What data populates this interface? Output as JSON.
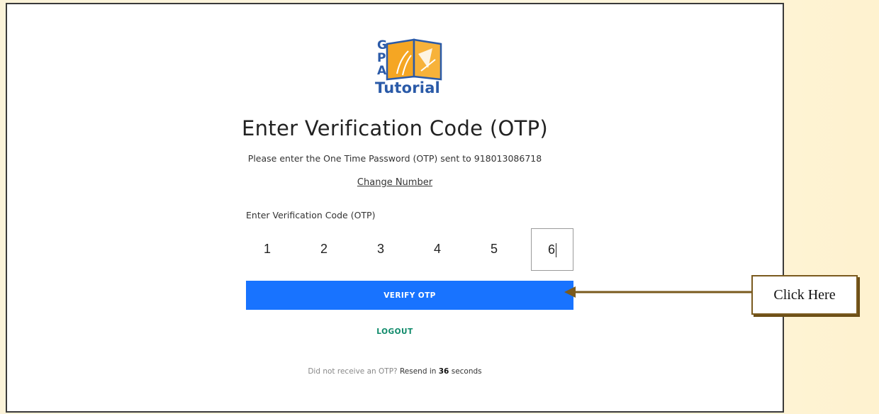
{
  "logo": {
    "letters": [
      "G",
      "P",
      "A"
    ],
    "wordmark": "Tutorial"
  },
  "title": "Enter Verification Code (OTP)",
  "subtitle": "Please enter the One Time Password (OTP) sent to 918013086718",
  "change_number": "Change Number",
  "otp": {
    "label": "Enter Verification Code (OTP)",
    "digits": [
      "1",
      "2",
      "3",
      "4",
      "5",
      "6"
    ],
    "active_index": 5
  },
  "verify_button": "VERIFY OTP",
  "logout": "LOGOUT",
  "resend": {
    "prefix": "Did not receive an OTP?",
    "middle": "Resend in",
    "seconds": "36",
    "suffix": "seconds"
  },
  "annotation": {
    "label": "Click Here"
  },
  "colors": {
    "primary": "#1873ff",
    "logout": "#0f8a6a",
    "logo_blue": "#2a5aa8",
    "logo_orange": "#f5a623",
    "arrow": "#7a5a1e"
  },
  "icons": {
    "logo": "open-book-logo-icon",
    "arrow": "pointer-arrow-icon"
  }
}
